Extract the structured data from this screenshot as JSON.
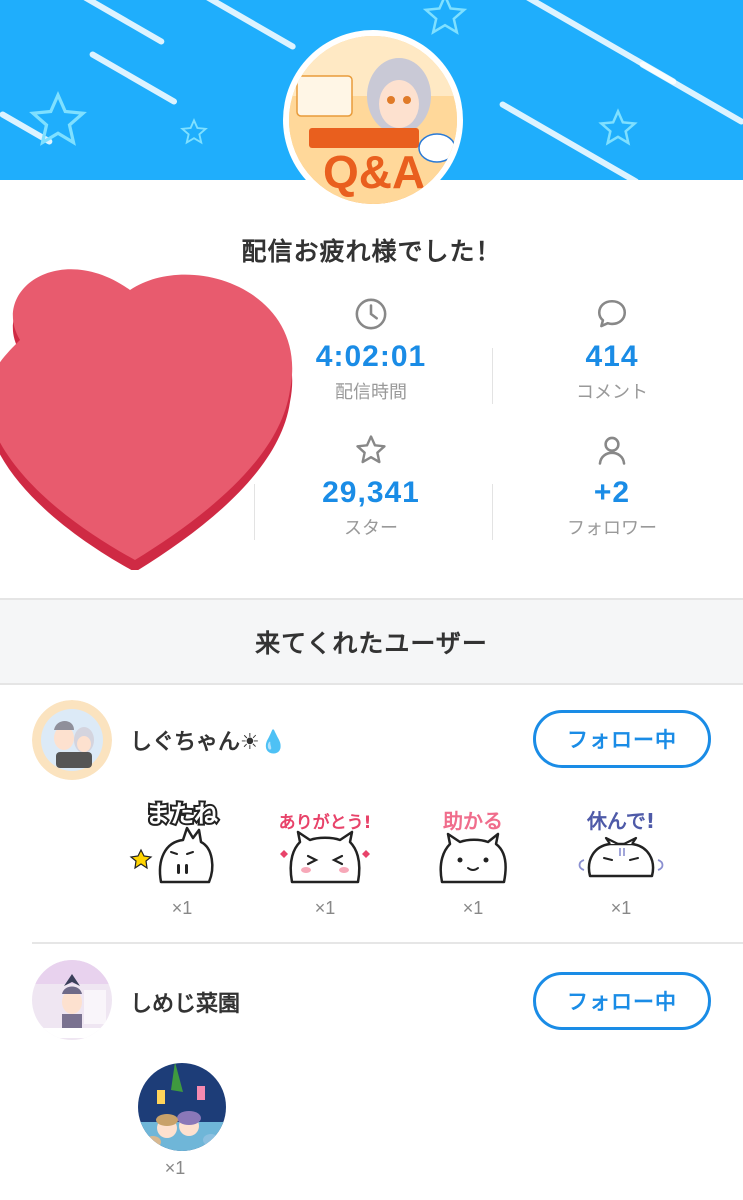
{
  "summary": {
    "title": "配信お疲れ様でした！",
    "stats": [
      {
        "icon": "clock-icon",
        "value": "4:02:01",
        "label": "配信時間"
      },
      {
        "icon": "comment-icon",
        "value": "414",
        "label": "コメント"
      },
      {
        "icon": "star-icon",
        "value": "29,341",
        "label": "スター"
      },
      {
        "icon": "person-icon",
        "value": "+2",
        "label": "フォロワー"
      }
    ]
  },
  "section": {
    "title": "来てくれたユーザー"
  },
  "users": [
    {
      "name": "しぐちゃん☀💧",
      "follow_label": "フォロー中",
      "stickers": [
        {
          "text": "またね",
          "count": "×1"
        },
        {
          "text": "ありがとう!",
          "count": "×1"
        },
        {
          "text": "助かる",
          "count": "×1"
        },
        {
          "text": "休んで!",
          "count": "×1"
        }
      ]
    },
    {
      "name": "しめじ菜園",
      "follow_label": "フォロー中",
      "stickers": [
        {
          "text": "",
          "count": "×1"
        }
      ]
    }
  ],
  "colors": {
    "accent": "#1a8ce6",
    "banner": "#1faefc",
    "heart": "#e85b6e"
  }
}
